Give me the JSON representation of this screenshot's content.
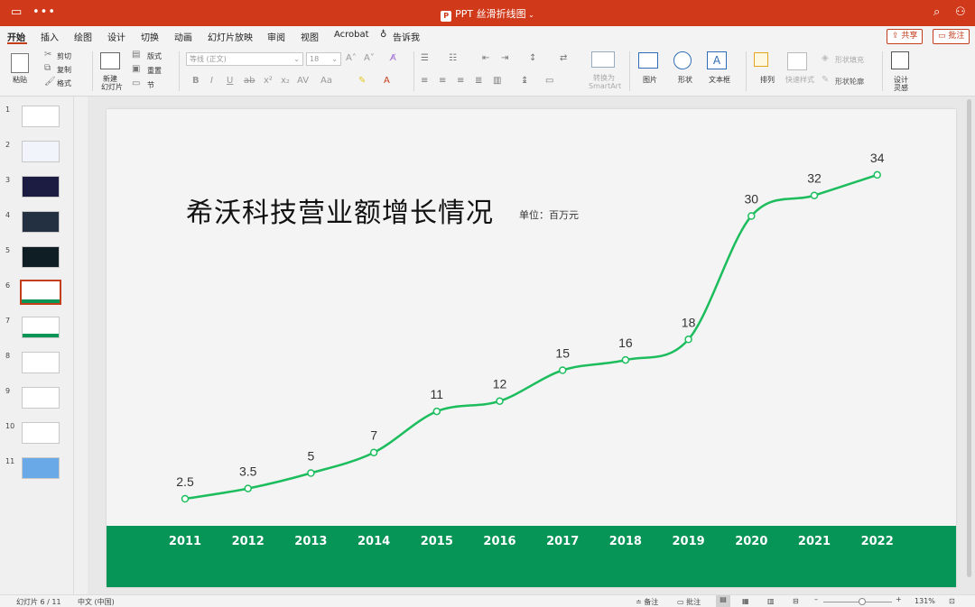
{
  "window": {
    "title": "PPT 丝滑折线图"
  },
  "tabs": [
    "开始",
    "插入",
    "绘图",
    "设计",
    "切换",
    "动画",
    "幻灯片放映",
    "审阅",
    "视图",
    "Acrobat",
    "告诉我"
  ],
  "header_buttons": {
    "share": "共享",
    "comment": "批注"
  },
  "ribbon": {
    "paste": "粘贴",
    "cut": "剪切",
    "copy": "复制",
    "format": "格式",
    "new_slide_l1": "新建",
    "new_slide_l2": "幻灯片",
    "layout": "版式",
    "reset": "重置",
    "section": "节",
    "font_name": "等线 (正文)",
    "font_size": "18",
    "convert_l1": "转换为",
    "convert_l2": "SmartArt",
    "picture": "图片",
    "shape": "形状",
    "textbox": "文本框",
    "arrange": "排列",
    "quick_styles": "快速样式",
    "shape_fill": "形状填充",
    "shape_outline": "形状轮廓",
    "designer_l1": "设计",
    "designer_l2": "灵感"
  },
  "thumbnails": [
    {
      "num": "1",
      "bg": "#ffffff"
    },
    {
      "num": "2",
      "bg": "#f2f4fb"
    },
    {
      "num": "3",
      "bg": "#1c1c42"
    },
    {
      "num": "4",
      "bg": "#233041"
    },
    {
      "num": "5",
      "bg": "#0f1e24"
    },
    {
      "num": "6",
      "bg": "#ffffff"
    },
    {
      "num": "7",
      "bg": "#ffffff"
    },
    {
      "num": "8",
      "bg": "#ffffff"
    },
    {
      "num": "9",
      "bg": "#ffffff"
    },
    {
      "num": "10",
      "bg": "#ffffff"
    },
    {
      "num": "11",
      "bg": "#6aa9e8"
    }
  ],
  "slide": {
    "title": "希沃科技营业额增长情况",
    "unit": "单位：百万元"
  },
  "chart_data": {
    "type": "line",
    "title": "希沃科技营业额增长情况",
    "categories": [
      "2011",
      "2012",
      "2013",
      "2014",
      "2015",
      "2016",
      "2017",
      "2018",
      "2019",
      "2020",
      "2021",
      "2022"
    ],
    "values": [
      2.5,
      3.5,
      5,
      7,
      11,
      12,
      15,
      16,
      18,
      30,
      32,
      34
    ],
    "data_labels": [
      "2.5",
      "3.5",
      "5",
      "7",
      "11",
      "12",
      "15",
      "16",
      "18",
      "30",
      "32",
      "34"
    ],
    "line_color": "#1dbd5e",
    "band_color": "#069457",
    "smooth": true
  },
  "status": {
    "slide_count": "幻灯片 6 / 11",
    "language": "中文 (中国)",
    "notes": "备注",
    "comments": "批注",
    "zoom": "131%"
  },
  "colors": {
    "accent": "#d03a1b",
    "band": "#069457",
    "line": "#1dbd5e"
  }
}
